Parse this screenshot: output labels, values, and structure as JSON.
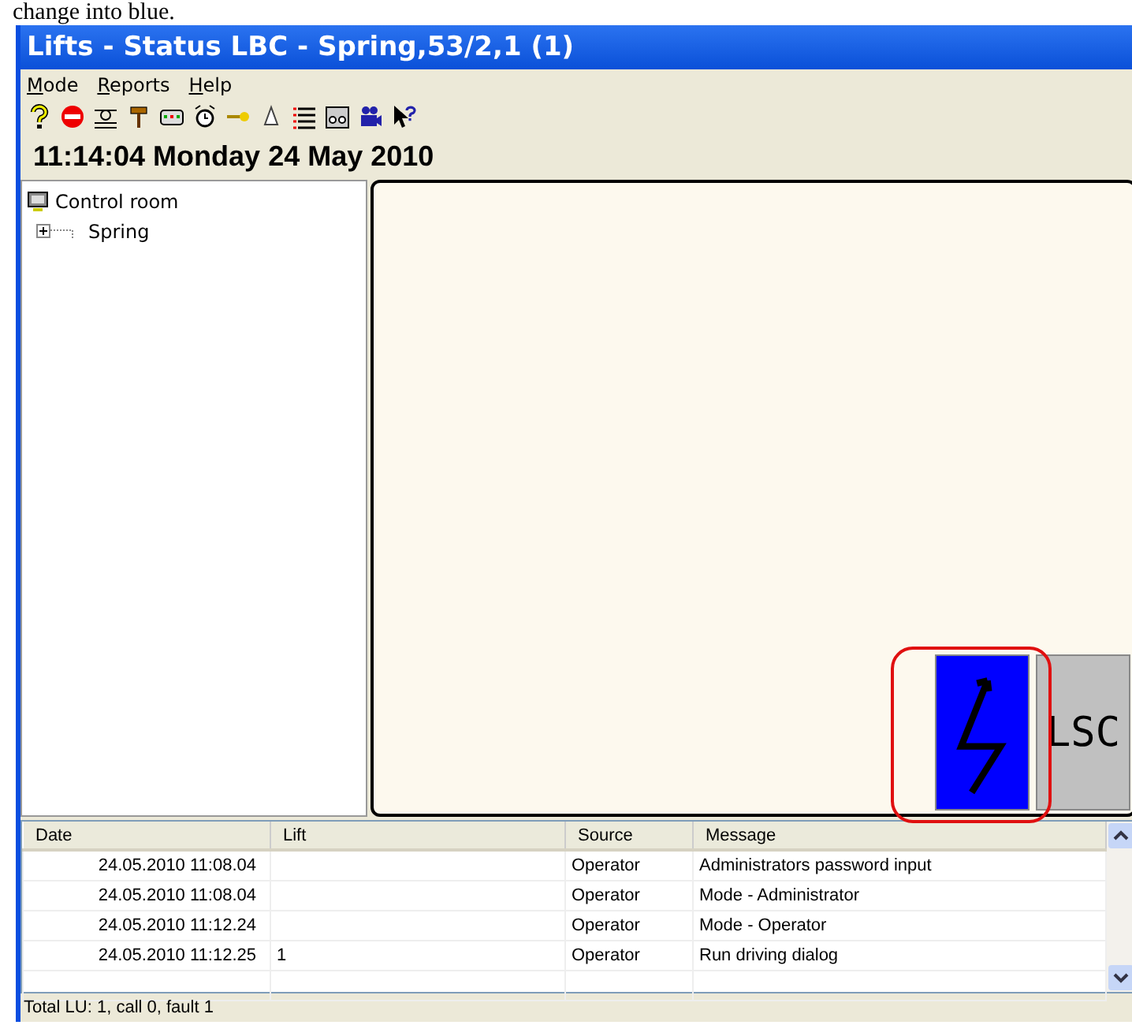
{
  "document_caption": "change into blue.",
  "window": {
    "title": "Lifts - Status LBC - Spring,53/2,1 (1)"
  },
  "menu": [
    {
      "label": "Mode"
    },
    {
      "label": "Reports"
    },
    {
      "label": "Help"
    }
  ],
  "clock": "11:14:04 Monday 24 May 2010",
  "tree": {
    "label": "Control room",
    "children": [
      {
        "label": "Spring",
        "expanded": false
      }
    ]
  },
  "canvas": {
    "tiles": [
      {
        "kind": "lightning",
        "color": "#0000ff"
      },
      {
        "kind": "text",
        "label": "LSC",
        "color": "#c0c0c0"
      }
    ],
    "highlight": true
  },
  "log": {
    "columns": [
      "Date",
      "Lift",
      "Source",
      "Message"
    ],
    "rows": [
      {
        "date": "24.05.2010 11:08.04",
        "source": "Operator",
        "message": "Administrators password input"
      },
      {
        "date": "24.05.2010 11:08.04",
        "source": "Operator",
        "message": "Mode - Administrator"
      },
      {
        "date": "24.05.2010 11:12.24",
        "source": "Operator",
        "message": "Mode - Operator"
      },
      {
        "date": "24.05.2010 11:12.25",
        "lift": "1",
        "source": "Operator",
        "message": "Run driving dialog"
      }
    ]
  },
  "status_bar": "Total LU: 1, call 0, fault 1"
}
